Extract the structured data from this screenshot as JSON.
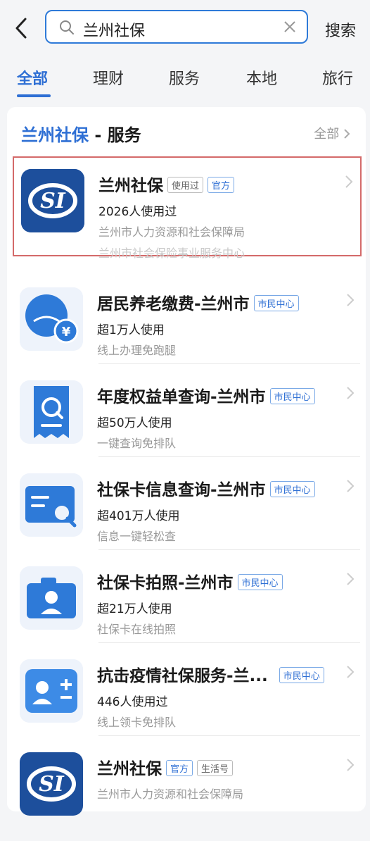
{
  "search": {
    "query": "兰州社保",
    "button": "搜索"
  },
  "tabs": [
    {
      "label": "全部"
    },
    {
      "label": "理财"
    },
    {
      "label": "服务"
    },
    {
      "label": "本地"
    },
    {
      "label": "旅行"
    }
  ],
  "section": {
    "title_highlight": "兰州社保",
    "title_rest": " - 服务",
    "more": "全部"
  },
  "items": [
    {
      "title": "兰州社保",
      "badges": [
        "使用过",
        "官方"
      ],
      "line1": "2026人使用过",
      "line2": "兰州市人力资源和社会保障局",
      "line3": "兰州市社会保险事业服务中心",
      "icon": "si-logo-icon"
    },
    {
      "title": "居民养老缴费-兰州市",
      "badges": [
        "市民中心"
      ],
      "line1": "超1万人使用",
      "line2": "线上办理免跑腿",
      "icon": "pension-icon"
    },
    {
      "title": "年度权益单查询-兰州市",
      "badges": [
        "市民中心"
      ],
      "line1": "超50万人使用",
      "line2": "一键查询免排队",
      "icon": "document-search-icon"
    },
    {
      "title": "社保卡信息查询-兰州市",
      "badges": [
        "市民中心"
      ],
      "line1": "超401万人使用",
      "line2": "信息一键轻松查",
      "icon": "card-search-icon"
    },
    {
      "title": "社保卡拍照-兰州市",
      "badges": [
        "市民中心"
      ],
      "line1": "超21万人使用",
      "line2": "社保卡在线拍照",
      "icon": "camera-person-icon"
    },
    {
      "title": "抗击疫情社保服务-兰...",
      "badges": [
        "市民中心"
      ],
      "line1": "446人使用过",
      "line2": "线上领卡免排队",
      "icon": "person-plus-icon"
    },
    {
      "title": "兰州社保",
      "badges": [
        "官方",
        "生活号"
      ],
      "line2": "兰州市人力资源和社会保障局",
      "icon": "si-logo-icon"
    }
  ],
  "colors": {
    "accent": "#2e6fd4",
    "selection": "#d46a6a"
  }
}
